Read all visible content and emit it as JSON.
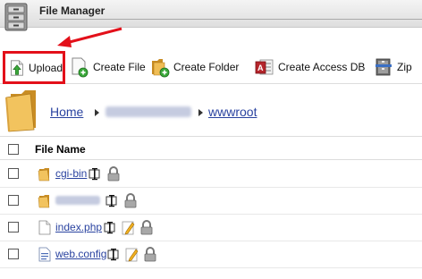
{
  "window": {
    "title": "File Manager"
  },
  "toolbar": {
    "upload": "Upload",
    "create_file": "Create File",
    "create_folder": "Create Folder",
    "create_access_db": "Create Access DB",
    "zip": "Zip"
  },
  "breadcrumb": {
    "home": "Home",
    "current": "wwwroot"
  },
  "table": {
    "header": "File Name",
    "rows": [
      {
        "name": "cgi-bin",
        "type": "folder"
      },
      {
        "name": "",
        "type": "folder"
      },
      {
        "name": "index.php",
        "type": "file"
      },
      {
        "name": "web.config",
        "type": "config"
      }
    ]
  },
  "colors": {
    "link": "#2a43a0",
    "highlight": "#e3101a",
    "folder": "#e8b24a"
  },
  "icons": [
    "file-manager-icon",
    "upload-icon",
    "create-file-icon",
    "create-folder-icon",
    "access-db-icon",
    "zip-icon",
    "folder-icon",
    "file-icon",
    "config-file-icon",
    "rename-icon",
    "edit-icon",
    "lock-icon"
  ]
}
